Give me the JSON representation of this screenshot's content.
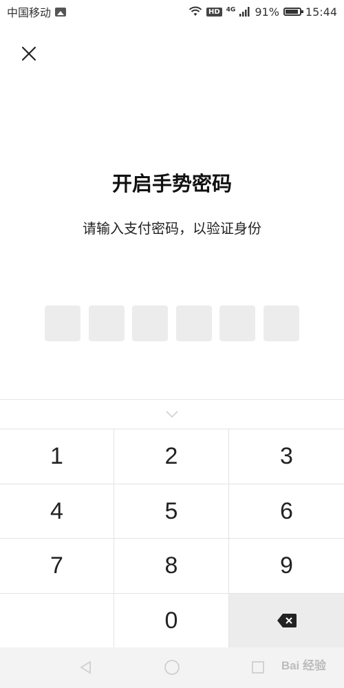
{
  "status_bar": {
    "carrier": "中国移动",
    "hd_label": "HD",
    "network_label": "4G",
    "battery_percent": "91%",
    "time": "15:44",
    "icons": [
      "image-icon",
      "wifi-icon",
      "signal-icon",
      "battery-icon"
    ]
  },
  "header": {
    "close_icon": "close-icon",
    "title": "开启手势密码",
    "subtitle": "请输入支付密码，以验证身份"
  },
  "pin": {
    "length": 6,
    "filled": 0
  },
  "keyboard": {
    "collapse_icon": "chevron-down-icon",
    "keys": [
      "1",
      "2",
      "3",
      "4",
      "5",
      "6",
      "7",
      "8",
      "9",
      "",
      "0",
      "delete"
    ],
    "delete_icon": "backspace-icon"
  },
  "navigation": {
    "icons": [
      "back-icon",
      "home-icon",
      "recent-apps-icon"
    ]
  },
  "watermark": {
    "text": "Bai 经验",
    "colors": {
      "text": "#aaaaaa"
    }
  }
}
